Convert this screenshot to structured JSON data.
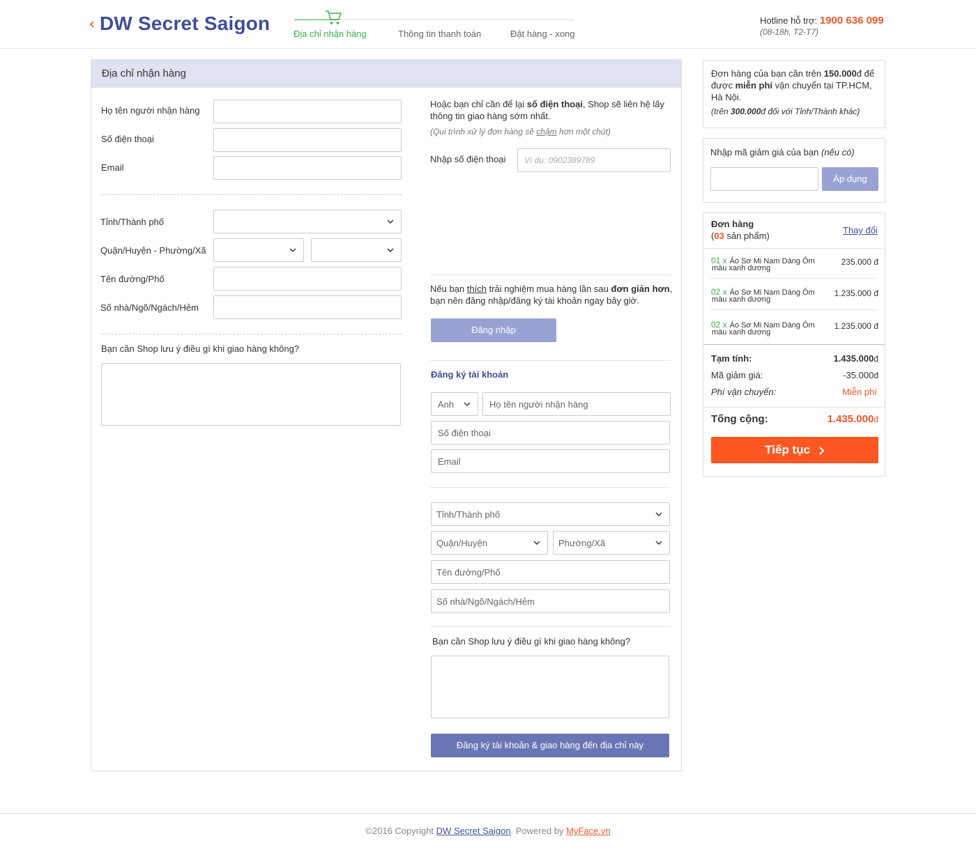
{
  "header": {
    "brand": "DW Secret Saigon",
    "steps": [
      "Địa chỉ nhận hàng",
      "Thông tin thanh toán",
      "Đặt hàng - xong"
    ],
    "hotline_label": "Hotline hỗ trợ:",
    "hotline_number": "1900 636 099",
    "hotline_hours": "(08-18h, T2-T7)"
  },
  "address_panel": {
    "title": "Địa chỉ nhận hàng",
    "labels": {
      "name": "Họ tên người nhận hàng",
      "phone": "Số điện thoại",
      "email": "Email",
      "city": "Tỉnh/Thành phố",
      "district_ward": "Quận/Huyện - Phường/Xã",
      "street": "Tên đường/Phố",
      "house": "Số nhà/Ngõ/Ngách/Hẻm",
      "note": "Bạn cần Shop lưu ý điều gì khi giao hàng không?"
    }
  },
  "phone_only": {
    "text_1": "Hoặc bạn chỉ cần để lại",
    "text_bold": "số điện thoại",
    "text_2": ", Shop sẽ liên hệ lấy thông tin giao hàng sớm nhất.",
    "note_1": "(Qui trình xử lý đơn hàng sẽ",
    "note_u": "chậm",
    "note_2": "hơn một chút)",
    "label": "Nhập số  điện thoại",
    "placeholder": "Ví dụ: 0902389789"
  },
  "login": {
    "text_1": "Nếu bạn",
    "text_u": "thích",
    "text_2": "trải nghiệm mua hàng lần sau",
    "text_bold": "đơn giản hơn",
    "text_3": ",",
    "text_4": "bạn nên đăng nhập/đăng ký tài khoản ngay bây giờ.",
    "button": "Đăng nhập"
  },
  "register": {
    "title": "Đăng ký tài khoản",
    "salutation": "Anh",
    "name_placeholder": "Họ tên người nhận hàng",
    "phone_placeholder": "Số điện thoại",
    "email_placeholder": "Email",
    "city_placeholder": "Tỉnh/Thành phố",
    "district_placeholder": "Quận/Huyện",
    "ward_placeholder": "Phường/Xã",
    "street_placeholder": "Tên đường/Phố",
    "house_placeholder": "Số nhà/Ngõ/Ngách/Hẻm",
    "note_label": "Bạn cần Shop lưu ý điều gì khi giao hàng không?",
    "submit": "Đăng ký tài khoản & giao hàng đến địa chỉ này"
  },
  "shipping_promo": {
    "t1": "Đơn hàng của bạn cần trên",
    "amount": "150.000",
    "currency": "đ",
    "t2": "để được",
    "free": "miễn phí",
    "t3": "vận chuyển tại",
    "t4": "TP.HCM, Hà Nội.",
    "other_1": "(trên",
    "other_amount": "300.000",
    "other_2": "đ đối với Tỉnh/Thành khác)"
  },
  "coupon": {
    "label": "Nhập mã giảm giá của bạn",
    "label_italic": "(nếu có)",
    "button": "Áp dụng"
  },
  "order": {
    "title": "Đơn hàng",
    "count_open": "(",
    "count": "03",
    "count_label": "sản phẩm)",
    "change": "Thay đổi",
    "items": [
      {
        "qty": "01 x",
        "name_1": "Áo Sơ Mi Nam Dáng Ôm",
        "name_2": "màu xanh dương",
        "price": "235.000 đ"
      },
      {
        "qty": "02 x",
        "name_1": "Áo Sơ Mi Nam Dáng Ôm",
        "name_2": "màu xanh dương",
        "price": "1.235.000 đ"
      },
      {
        "qty": "02 x",
        "name_1": "Áo Sơ Mi Nam Dáng Ôm",
        "name_2": "màu xanh dương",
        "price": "1.235.000 đ"
      }
    ],
    "subtotal_label": "Tạm tính:",
    "subtotal": "1.435.000",
    "discount_label": "Mã giảm giá:",
    "discount": "-35.000",
    "shipping_label": "Phí vận chuyển:",
    "shipping": "Miễn phí",
    "total_label": "Tổng cộng:",
    "total": "1.435.000",
    "currency": "đ",
    "continue": "Tiếp tục"
  },
  "footer": {
    "copyright": "©2016 Copyright",
    "brand_link": "DW Secret Saigon",
    "powered": ". Powered by",
    "powered_link": "MyFace.vn"
  },
  "colors": {
    "brand": "#3e4f96",
    "accent": "#f2572b",
    "success": "#3fae49",
    "panel_head": "#dfe2f0",
    "button_blue": "#6a75b5",
    "button_light": "#9aa2d3"
  }
}
